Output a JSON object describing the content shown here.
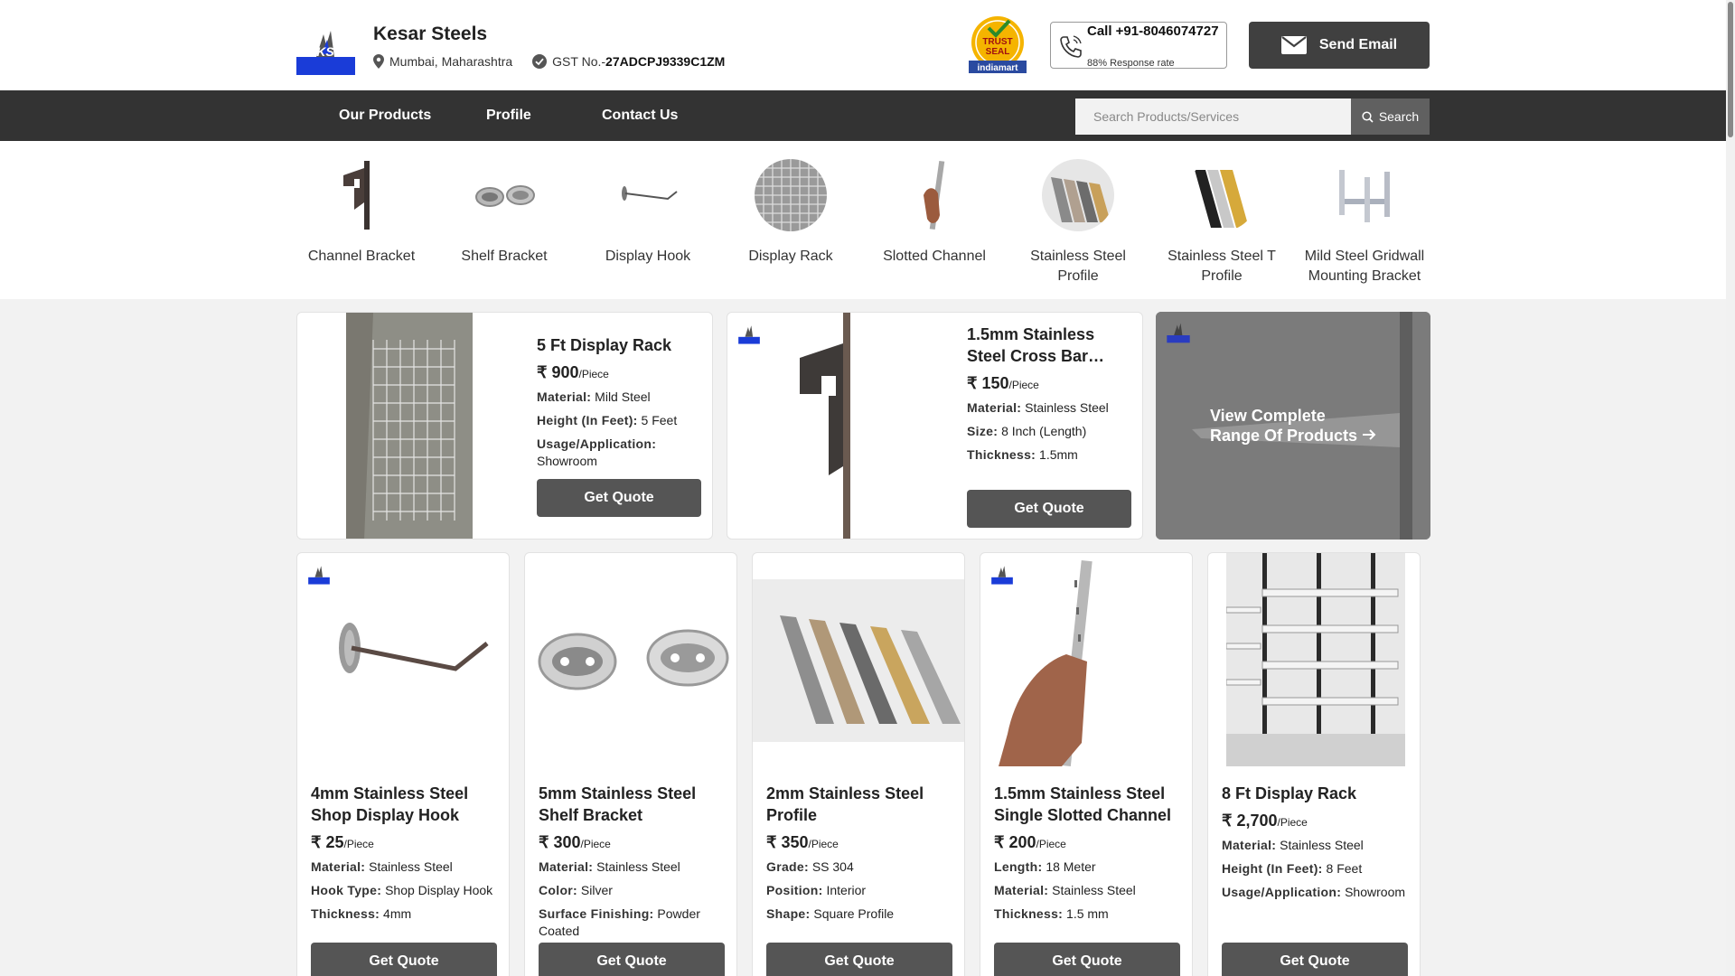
{
  "header": {
    "company_name": "Kesar Steels",
    "location": "Mumbai, Maharashtra",
    "gst_label": "GST No.-",
    "gst_number": "27ADCPJ9339C1ZM",
    "call_label": "Call +91-8046074727",
    "response_rate": "88% Response rate",
    "email_button": "Send Email"
  },
  "nav": {
    "items": [
      "Our Products",
      "Profile",
      "Contact Us"
    ],
    "search_placeholder": "Search Products/Services",
    "search_button": "Search"
  },
  "categories": [
    {
      "label": "Channel Bracket"
    },
    {
      "label": "Shelf Bracket"
    },
    {
      "label": "Display Hook"
    },
    {
      "label": "Display Rack"
    },
    {
      "label": "Slotted Channel"
    },
    {
      "label": "Stainless Steel Profile"
    },
    {
      "label": "Stainless Steel T Profile"
    },
    {
      "label": "Mild Steel Gridwall Mounting Bracket"
    }
  ],
  "featured": [
    {
      "title": "5 Ft Display Rack",
      "price": "900",
      "unit": "/Piece",
      "specs": [
        {
          "k": "Material:",
          "v": "Mild Steel"
        },
        {
          "k": "Height (In Feet):",
          "v": "5 Feet"
        },
        {
          "k": "Usage/Application:",
          "v": "Showroom"
        }
      ],
      "cta": "Get Quote"
    },
    {
      "title": "1.5mm Stainless Steel Cross Bar…",
      "price": "150",
      "unit": "/Piece",
      "specs": [
        {
          "k": "Material:",
          "v": "Stainless Steel"
        },
        {
          "k": "Size:",
          "v": "8 Inch (Length)"
        },
        {
          "k": "Thickness:",
          "v": "1.5mm"
        }
      ],
      "cta": "Get Quote"
    }
  ],
  "view_all": {
    "line1": "View Complete",
    "line2": "Range Of Products"
  },
  "products": [
    {
      "title": "4mm Stainless Steel Shop Display Hook",
      "price": "25",
      "unit": "/Piece",
      "specs": [
        {
          "k": "Material:",
          "v": "Stainless Steel"
        },
        {
          "k": "Hook Type:",
          "v": "Shop Display Hook"
        },
        {
          "k": "Thickness:",
          "v": "4mm"
        }
      ],
      "cta": "Get Quote"
    },
    {
      "title": "5mm Stainless Steel Shelf Bracket",
      "price": "300",
      "unit": "/Piece",
      "specs": [
        {
          "k": "Material:",
          "v": "Stainless Steel"
        },
        {
          "k": "Color:",
          "v": "Silver"
        },
        {
          "k": "Surface Finishing:",
          "v": "Powder Coated"
        }
      ],
      "cta": "Get Quote"
    },
    {
      "title": "2mm Stainless Steel Profile",
      "price": "350",
      "unit": "/Piece",
      "specs": [
        {
          "k": "Grade:",
          "v": "SS 304"
        },
        {
          "k": "Position:",
          "v": "Interior"
        },
        {
          "k": "Shape:",
          "v": "Square Profile"
        }
      ],
      "cta": "Get Quote"
    },
    {
      "title": "1.5mm Stainless Steel Single Slotted Channel",
      "price": "200",
      "unit": "/Piece",
      "specs": [
        {
          "k": "Length:",
          "v": "18 Meter"
        },
        {
          "k": "Material:",
          "v": "Stainless Steel"
        },
        {
          "k": "Thickness:",
          "v": "1.5 mm"
        }
      ],
      "cta": "Get Quote"
    },
    {
      "title": "8 Ft Display Rack",
      "price": "2,700",
      "unit": "/Piece",
      "specs": [
        {
          "k": "Material:",
          "v": "Stainless Steel"
        },
        {
          "k": "Height (In Feet):",
          "v": "8 Feet"
        },
        {
          "k": "Usage/Application:",
          "v": "Showroom"
        }
      ],
      "cta": "Get Quote"
    }
  ],
  "badges": {
    "logo_text": "KS",
    "trust_line1": "TRUST",
    "trust_line2": "SEAL",
    "trust_brand": "indiamart"
  },
  "icons": {
    "location": "location-pin-icon",
    "verified": "verified-check-icon",
    "phone": "phone-icon",
    "email": "envelope-icon",
    "search": "search-icon",
    "arrow": "arrow-right-icon",
    "rupee": "rupee-icon"
  },
  "colors": {
    "nav_bg": "#333333",
    "button_bg": "#555555",
    "email_bg": "#404040",
    "logo_blue": "#1a3cd8"
  }
}
